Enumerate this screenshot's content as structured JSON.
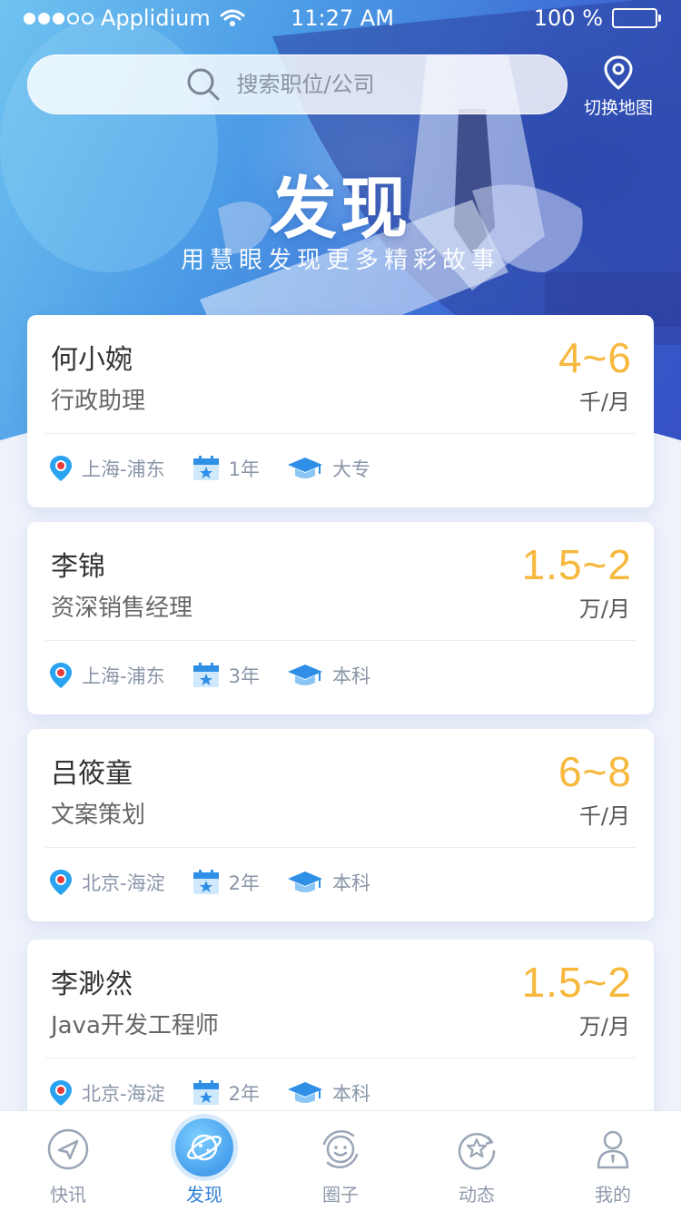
{
  "status_bar": {
    "carrier": "Applidium",
    "time": "11:27 AM",
    "battery": "100 %"
  },
  "search": {
    "placeholder": "搜索职位/公司"
  },
  "map_switch": {
    "label": "切换地图"
  },
  "hero": {
    "title": "发现",
    "subtitle": "用慧眼发现更多精彩故事"
  },
  "colors": {
    "accent": "#2e7fd9",
    "salary": "#f7b83e"
  },
  "jobs": [
    {
      "name": "何小婉",
      "role": "行政助理",
      "salary": "4~6",
      "unit": "千/月",
      "location": "上海-浦东",
      "experience": "1年",
      "education": "大专"
    },
    {
      "name": "李锦",
      "role": "资深销售经理",
      "salary": "1.5~2",
      "unit": "万/月",
      "location": "上海-浦东",
      "experience": "3年",
      "education": "本科"
    },
    {
      "name": "吕筱童",
      "role": "文案策划",
      "salary": "6~8",
      "unit": "千/月",
      "location": "北京-海淀",
      "experience": "2年",
      "education": "本科"
    },
    {
      "name": "李渺然",
      "role": "Java开发工程师",
      "salary": "1.5~2",
      "unit": "万/月",
      "location": "北京-海淀",
      "experience": "2年",
      "education": "本科"
    }
  ],
  "tabs": [
    {
      "label": "快讯",
      "icon": "send-icon"
    },
    {
      "label": "发现",
      "icon": "planet-icon",
      "active": true
    },
    {
      "label": "圈子",
      "icon": "orbit-smile-icon"
    },
    {
      "label": "动态",
      "icon": "star-refresh-icon"
    },
    {
      "label": "我的",
      "icon": "person-icon"
    }
  ]
}
